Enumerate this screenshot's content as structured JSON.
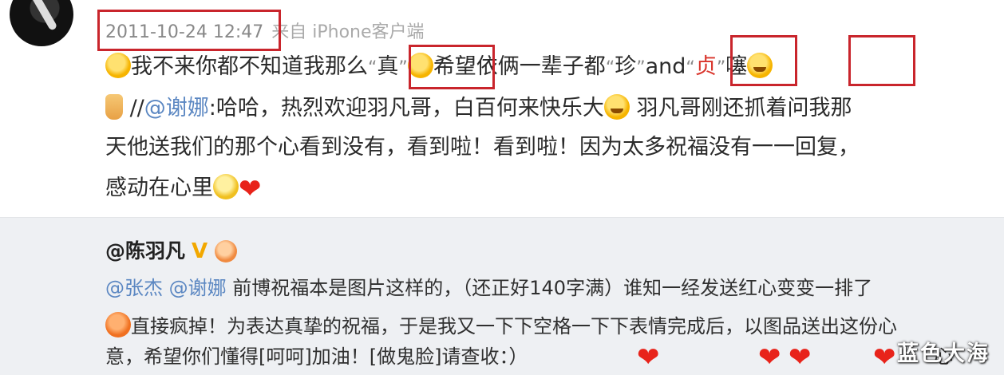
{
  "post": {
    "timestamp": "2011-10-24 12:47",
    "source": "来自 iPhone客户端",
    "line1": {
      "pre": "我不来你都不知道我那么",
      "char1": "真",
      "mid": "希望依俩一辈子都",
      "char2": "珍",
      "and": "and",
      "char3": "贞",
      "post": "噻"
    },
    "line2": {
      "prefix": " //",
      "mention": "@谢娜",
      "text": ":哈哈，热烈欢迎羽凡哥，白百何来快乐大",
      "text2": " 羽凡哥刚还抓着问我那"
    },
    "line3": "天他送我们的那个心看到没有，看到啦！看到啦！因为太多祝福没有一一回复，",
    "line4": "感动在心里"
  },
  "reply": {
    "author": "@陈羽凡",
    "badge": "V",
    "line1_mentions": "@张杰 @谢娜",
    "line1_text": " 前博祝福本是图片这样的，（还正好140字满）谁知一经发送红心变变一排了",
    "line2": "直接疯掉！为表达真挚的祝福，于是我又一下下空格一下下表情完成后，以图品送出这份心",
    "line3": "意，希望你们懂得[呵呵]加油！[做鬼脸]请查收：）",
    "line3_end": "心"
  },
  "watermark": "蓝色大海",
  "colors": {
    "highlight_box": "#c9252c",
    "mention": "#5b87c2",
    "heart": "#e8231a"
  }
}
